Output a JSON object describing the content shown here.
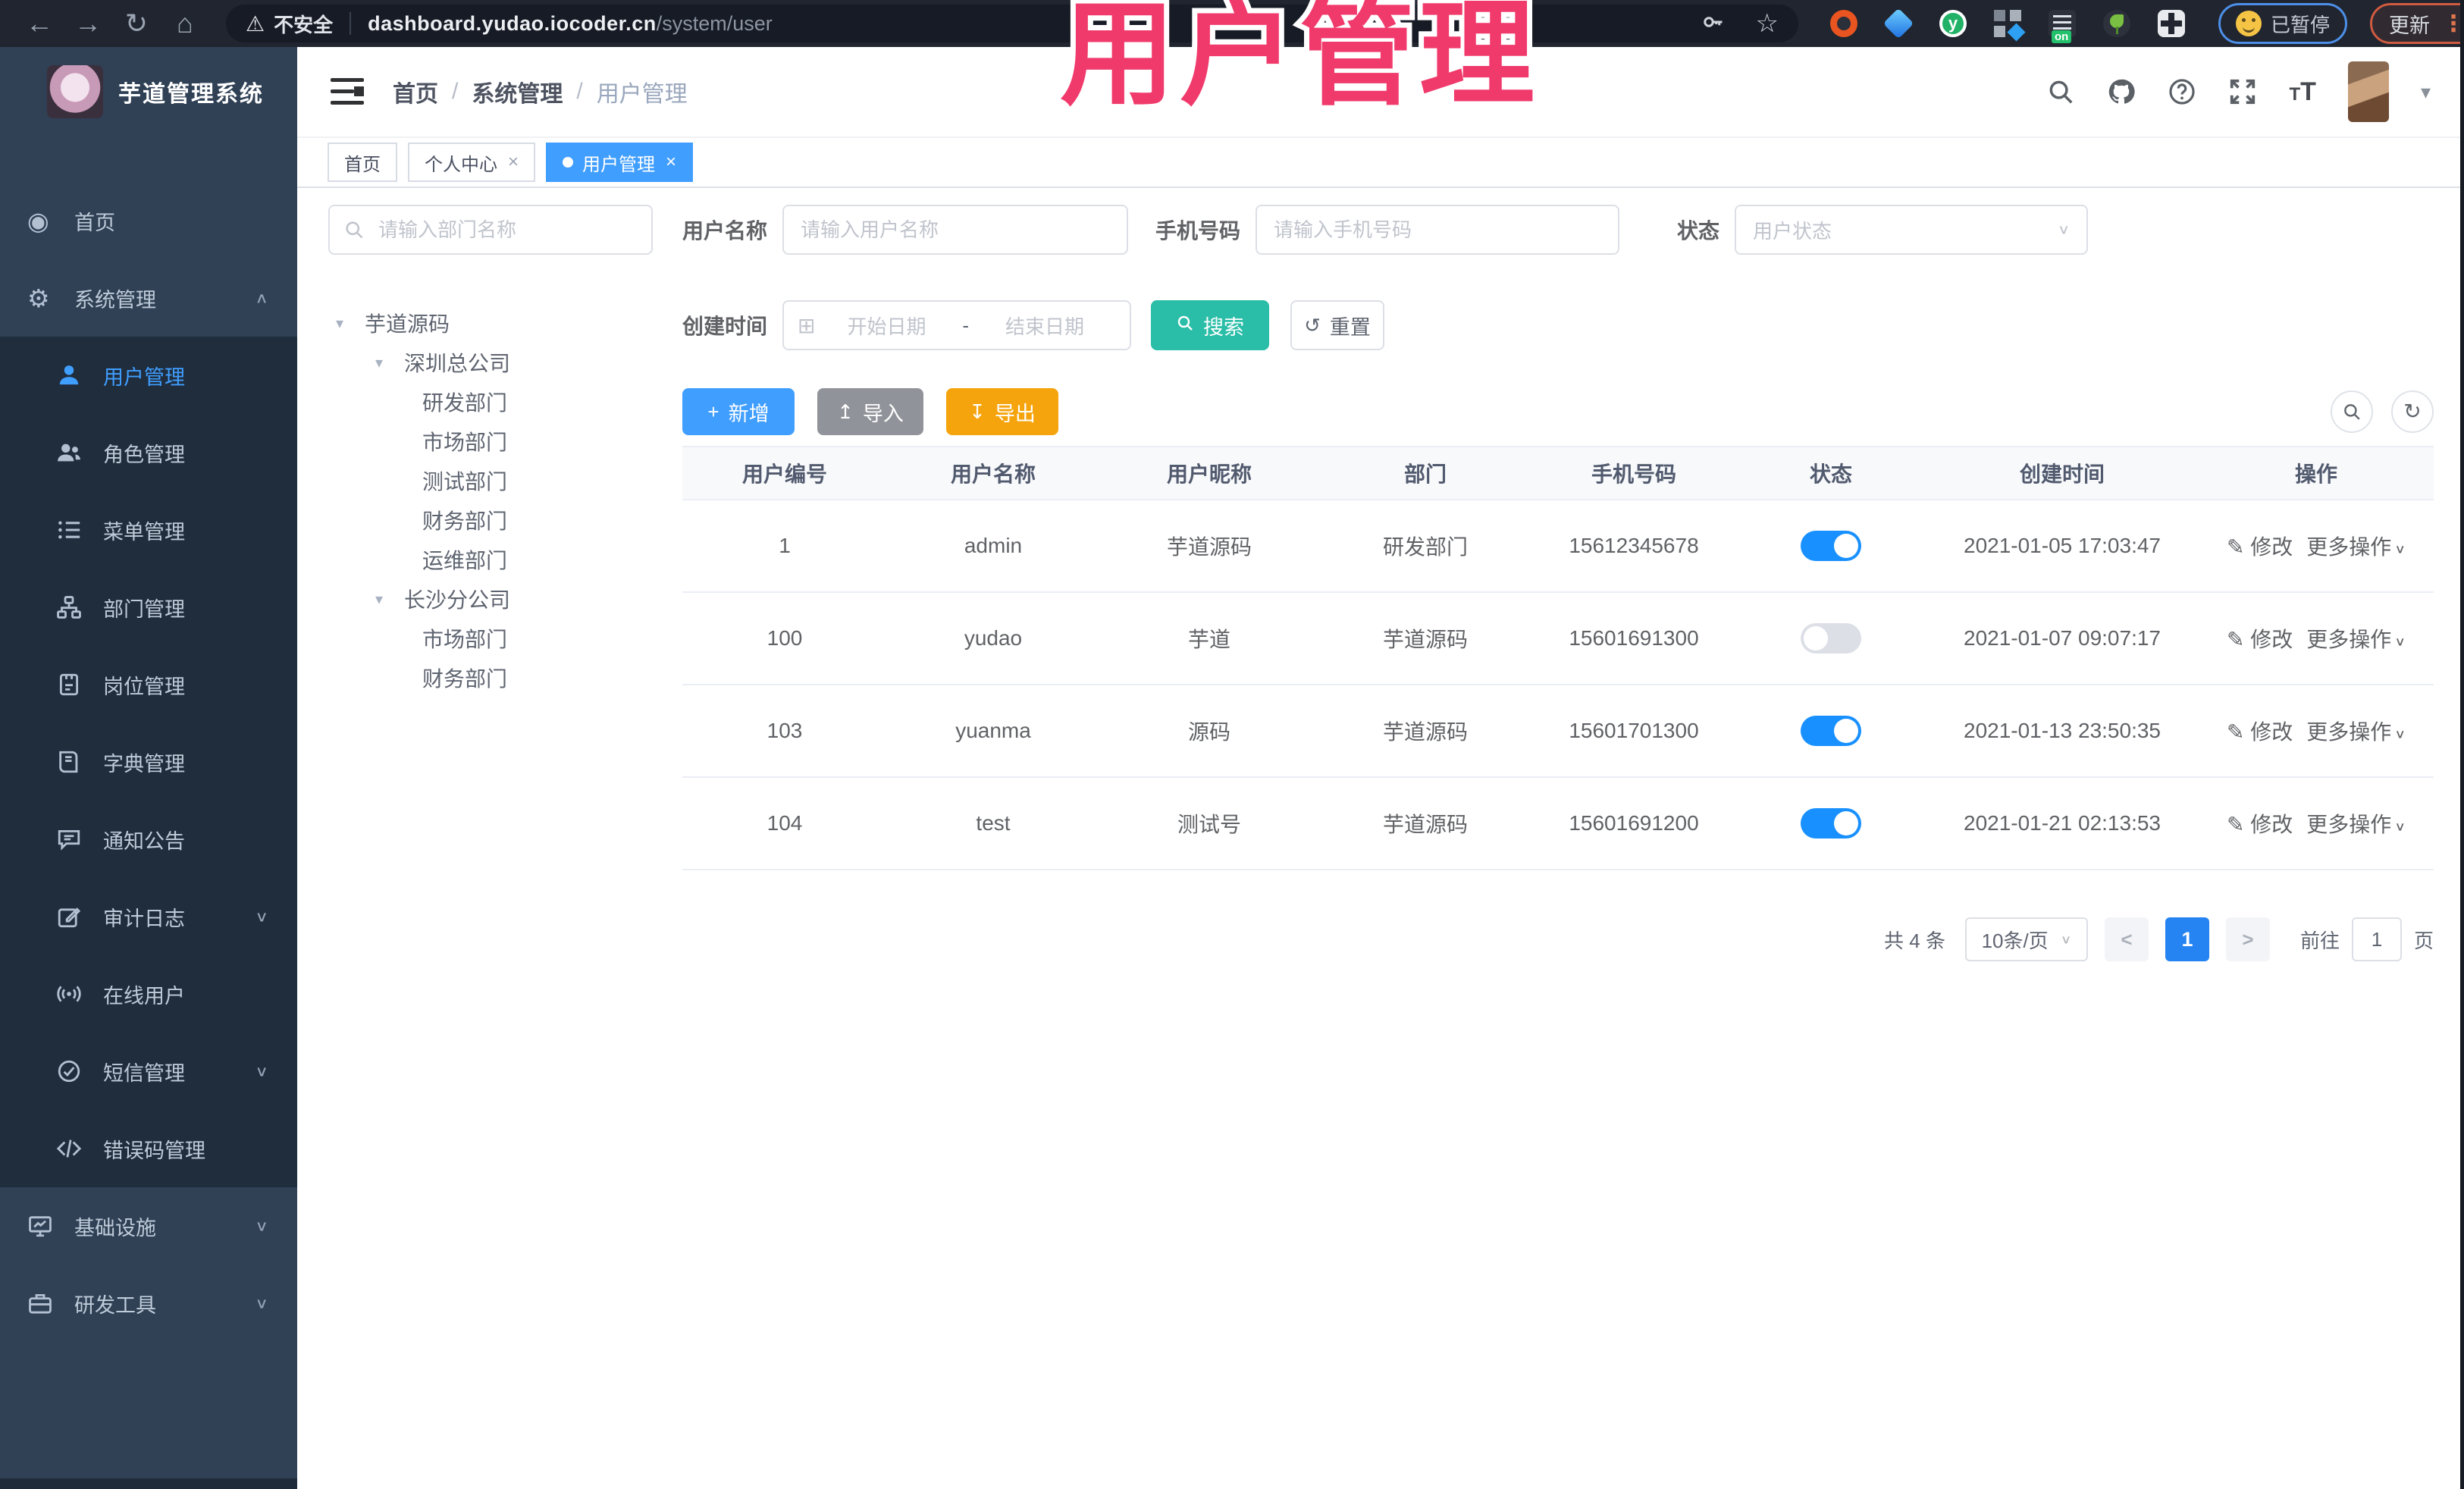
{
  "browser": {
    "security_label": "不安全",
    "url_host": "dashboard.yudao.iocoder.cn",
    "url_path": "/system/user",
    "paused_badge": "已暂停",
    "update_button": "更新"
  },
  "overlay": {
    "title": "用户管理",
    "color": "#f13a6c"
  },
  "icons": {
    "back": "←",
    "forward": "→",
    "reload": "↻",
    "home": "⌂",
    "warning": "⚠",
    "star": "☆",
    "menu_dots": "⋮",
    "caret_down": "∨",
    "caret_up": "∧",
    "tree_caret": "▾",
    "dropdown_caret": "▾",
    "plus": "+",
    "import_arrow": "↥",
    "export_arrow": "↧",
    "reset": "↺",
    "calendar": "⊞",
    "edit": "✎",
    "dashboard": "◉",
    "gear": "⚙",
    "close": "×",
    "prev": "<",
    "next": ">",
    "refresh": "↻"
  },
  "sidebar": {
    "app_title": "芋道管理系统",
    "items": [
      {
        "label": "首页"
      },
      {
        "label": "系统管理",
        "expanded": true
      },
      {
        "label": "用户管理",
        "active": true
      },
      {
        "label": "角色管理"
      },
      {
        "label": "菜单管理"
      },
      {
        "label": "部门管理"
      },
      {
        "label": "岗位管理"
      },
      {
        "label": "字典管理"
      },
      {
        "label": "通知公告"
      },
      {
        "label": "审计日志",
        "collapsed": true
      },
      {
        "label": "在线用户"
      },
      {
        "label": "短信管理",
        "collapsed": true
      },
      {
        "label": "错误码管理"
      },
      {
        "label": "基础设施",
        "collapsed": true
      },
      {
        "label": "研发工具",
        "collapsed": true
      }
    ]
  },
  "header": {
    "breadcrumb": [
      "首页",
      "系统管理",
      "用户管理"
    ]
  },
  "tabs": [
    {
      "label": "首页",
      "closable": false,
      "active": false
    },
    {
      "label": "个人中心",
      "closable": true,
      "active": false
    },
    {
      "label": "用户管理",
      "closable": true,
      "active": true
    }
  ],
  "tree_panel": {
    "search_placeholder": "请输入部门名称",
    "nodes": [
      {
        "label": "芋道源码",
        "level": 1,
        "expanded": true
      },
      {
        "label": "深圳总公司",
        "level": 2,
        "expanded": true
      },
      {
        "label": "研发部门",
        "level": 3
      },
      {
        "label": "市场部门",
        "level": 3
      },
      {
        "label": "测试部门",
        "level": 3
      },
      {
        "label": "财务部门",
        "level": 3
      },
      {
        "label": "运维部门",
        "level": 3
      },
      {
        "label": "长沙分公司",
        "level": 2,
        "expanded": true
      },
      {
        "label": "市场部门",
        "level": 3
      },
      {
        "label": "财务部门",
        "level": 3
      }
    ]
  },
  "filters": {
    "username_label": "用户名称",
    "username_placeholder": "请输入用户名称",
    "mobile_label": "手机号码",
    "mobile_placeholder": "请输入手机号码",
    "status_label": "状态",
    "status_placeholder": "用户状态",
    "create_time_label": "创建时间",
    "date_start_placeholder": "开始日期",
    "date_separator": "-",
    "date_end_placeholder": "结束日期",
    "search_button": "搜索",
    "reset_button": "重置"
  },
  "toolbar": {
    "add": "新增",
    "import": "导入",
    "export": "导出"
  },
  "table": {
    "columns": [
      "用户编号",
      "用户名称",
      "用户昵称",
      "部门",
      "手机号码",
      "状态",
      "创建时间",
      "操作"
    ],
    "edit_label": "修改",
    "more_label": "更多操作",
    "rows": [
      {
        "id": "1",
        "username": "admin",
        "nickname": "芋道源码",
        "dept": "研发部门",
        "mobile": "15612345678",
        "status": true,
        "created": "2021-01-05 17:03:47"
      },
      {
        "id": "100",
        "username": "yudao",
        "nickname": "芋道",
        "dept": "芋道源码",
        "mobile": "15601691300",
        "status": false,
        "created": "2021-01-07 09:07:17"
      },
      {
        "id": "103",
        "username": "yuanma",
        "nickname": "源码",
        "dept": "芋道源码",
        "mobile": "15601701300",
        "status": true,
        "created": "2021-01-13 23:50:35"
      },
      {
        "id": "104",
        "username": "test",
        "nickname": "测试号",
        "dept": "芋道源码",
        "mobile": "15601691200",
        "status": true,
        "created": "2021-01-21 02:13:53"
      }
    ]
  },
  "pagination": {
    "total_text": "共 4 条",
    "page_size": "10条/页",
    "current_page": "1",
    "goto_label": "前往",
    "goto_value": "1",
    "page_unit": "页"
  }
}
